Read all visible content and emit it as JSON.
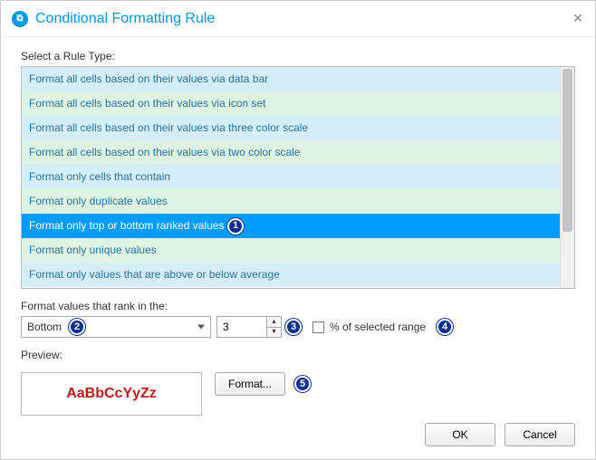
{
  "dialog": {
    "title": "Conditional Formatting Rule"
  },
  "labels": {
    "select_rule_type": "Select a Rule Type:",
    "format_values_rank": "Format values that rank in the:",
    "percent_of_range": "% of selected range",
    "preview": "Preview:"
  },
  "rule_types": {
    "items": [
      "Format all cells based on their values via data bar",
      "Format all cells based on their values via icon set",
      "Format all cells based on their values via three color scale",
      "Format all cells based on their values via two color scale",
      "Format only cells that contain",
      "Format only duplicate values",
      "Format only top or bottom ranked values",
      "Format only unique values",
      "Format only values that are above or below average"
    ],
    "selected_index": 6
  },
  "rank": {
    "direction": "Bottom",
    "count": "3",
    "percent_checked": false
  },
  "preview": {
    "sample_text": "AaBbCcYyZz"
  },
  "buttons": {
    "format": "Format...",
    "ok": "OK",
    "cancel": "Cancel"
  },
  "annotations": {
    "b1": "1",
    "b2": "2",
    "b3": "3",
    "b4": "4",
    "b5": "5"
  }
}
